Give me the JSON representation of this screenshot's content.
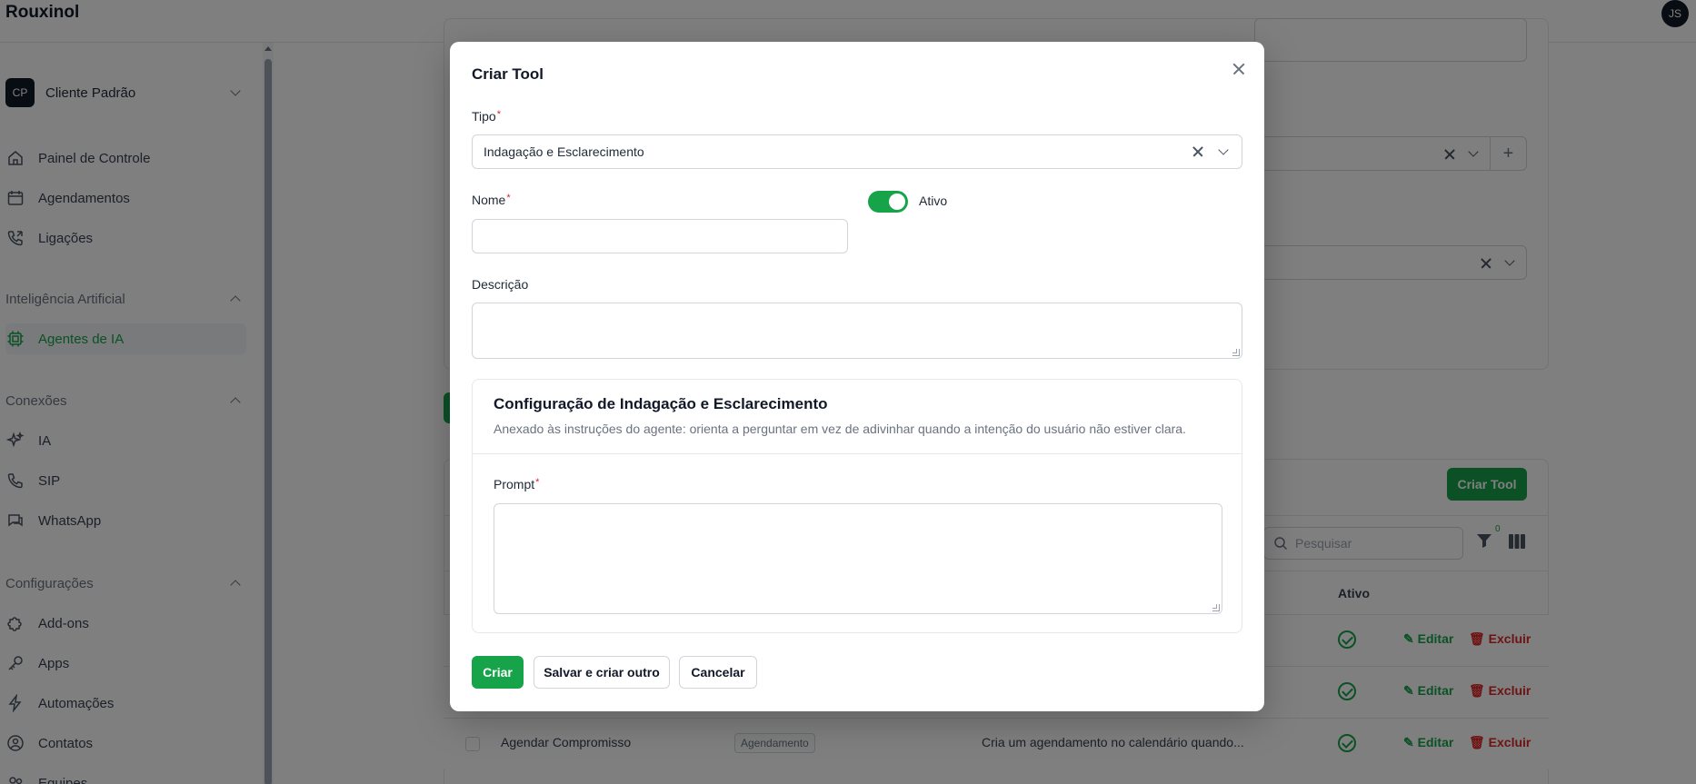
{
  "app": {
    "brand": "Rouxinol",
    "user_initials": "JS"
  },
  "sidebar": {
    "tenant": {
      "badge": "CP",
      "name": "Cliente Padrão"
    },
    "items_top": [
      {
        "label": "Painel de Controle",
        "icon": "home-icon"
      },
      {
        "label": "Agendamentos",
        "icon": "calendar-icon"
      },
      {
        "label": "Ligações",
        "icon": "phone-call-icon"
      }
    ],
    "groups": {
      "ai": "Inteligência Artificial",
      "connections": "Conexões",
      "settings": "Configurações"
    },
    "ai_items": [
      {
        "label": "Agentes de IA",
        "icon": "cpu-icon"
      }
    ],
    "connection_items": [
      {
        "label": "IA",
        "icon": "sparkles-icon"
      },
      {
        "label": "SIP",
        "icon": "phone-icon"
      },
      {
        "label": "WhatsApp",
        "icon": "chat-icon"
      }
    ],
    "settings_items": [
      {
        "label": "Add-ons",
        "icon": "puzzle-icon"
      },
      {
        "label": "Apps",
        "icon": "key-icon"
      },
      {
        "label": "Automações",
        "icon": "bolt-icon"
      },
      {
        "label": "Contatos",
        "icon": "user-circle-icon"
      },
      {
        "label": "Equipes",
        "icon": "users-icon"
      }
    ]
  },
  "background": {
    "create_tool_button": "Criar Tool",
    "search_placeholder": "Pesquisar",
    "filter_count": "0",
    "col_active": "Ativo",
    "edit_label": "Editar",
    "delete_label": "Excluir",
    "last_row": {
      "name": "Agendar Compromisso",
      "type": "Agendamento",
      "description": "Cria um agendamento no calendário quando..."
    }
  },
  "modal": {
    "title": "Criar Tool",
    "type_label": "Tipo",
    "type_value": "Indagação e Esclarecimento",
    "name_label": "Nome",
    "name_value": "",
    "active_label": "Ativo",
    "active": true,
    "description_label": "Descrição",
    "description_value": "",
    "config": {
      "title": "Configuração de Indagação e Esclarecimento",
      "description": "Anexado às instruções do agente: orienta a perguntar em vez de adivinhar quando a intenção do usuário não estiver clara.",
      "prompt_label": "Prompt",
      "prompt_value": ""
    },
    "buttons": {
      "create": "Criar",
      "save_and_create": "Salvar e criar outro",
      "cancel": "Cancelar"
    }
  },
  "colors": {
    "accent": "#16a34a",
    "danger": "#dc2626",
    "overlay": "rgba(0,0,0,0.5)"
  }
}
